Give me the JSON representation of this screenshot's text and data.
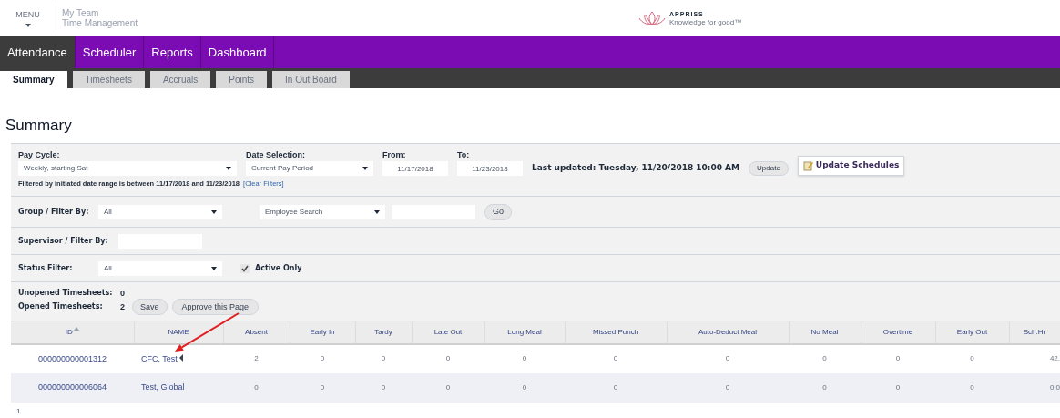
{
  "header": {
    "menu_label": "MENU",
    "app_title": [
      "My Team",
      "Time Management"
    ],
    "logo": {
      "name": "APPRISS",
      "tagline": "Knowledge for good™"
    }
  },
  "nav": [
    {
      "label": "Attendance",
      "selected": true
    },
    {
      "label": "Scheduler",
      "selected": false
    },
    {
      "label": "Reports",
      "selected": false
    },
    {
      "label": "Dashboard",
      "selected": false
    }
  ],
  "tabs": [
    {
      "label": "Summary",
      "selected": true
    },
    {
      "label": "Timesheets",
      "selected": false
    },
    {
      "label": "Accruals",
      "selected": false
    },
    {
      "label": "Points",
      "selected": false
    },
    {
      "label": "In Out Board",
      "selected": false
    }
  ],
  "page_title": "Summary",
  "pay_cycle": {
    "label": "Pay Cycle:",
    "value": "Weekly, starting Sat"
  },
  "date_selection": {
    "label": "Date Selection:",
    "value": "Current Pay Period"
  },
  "from": {
    "label": "From:",
    "value": "11/17/2018"
  },
  "to": {
    "label": "To:",
    "value": "11/23/2018"
  },
  "last_updated": "Last updated: Tuesday, 11/20/2018 10:00 AM",
  "update_button": "Update",
  "update_schedules_button": "Update Schedules",
  "filter_note": "Filtered by initiated date range is between 11/17/2018 and 11/23/2018",
  "clear_filters": "[Clear Filters]",
  "group_filter": {
    "label": "Group / Filter By:",
    "value": "All",
    "search_type": "Employee Search",
    "go": "Go"
  },
  "supervisor_filter": {
    "label": "Supervisor / Filter By:"
  },
  "status_filter": {
    "label": "Status Filter:",
    "value": "All",
    "active_only": {
      "label": "Active Only",
      "checked": true
    }
  },
  "unopened": {
    "label": "Unopened Timesheets:",
    "count": "0"
  },
  "opened": {
    "label": "Opened Timesheets:",
    "count": "2"
  },
  "save_button": "Save",
  "approve_button": "Approve this Page",
  "table": {
    "columns": [
      "ID",
      "NAME",
      "Absent",
      "Early In",
      "Tardy",
      "Late Out",
      "Long Meal",
      "Missed Punch",
      "Auto-Deduct Meal",
      "No Meal",
      "Overtime",
      "Early Out",
      "Sch.Hr"
    ],
    "rows": [
      [
        "000000000001312",
        "CFC, Test",
        "2",
        "0",
        "0",
        "0",
        "0",
        "0",
        "0",
        "0",
        "0",
        "0",
        "42."
      ],
      [
        "000000000006064",
        "Test, Global",
        "0",
        "0",
        "0",
        "0",
        "0",
        "0",
        "0",
        "0",
        "0",
        "0",
        "0.0"
      ]
    ]
  },
  "pager": "1"
}
